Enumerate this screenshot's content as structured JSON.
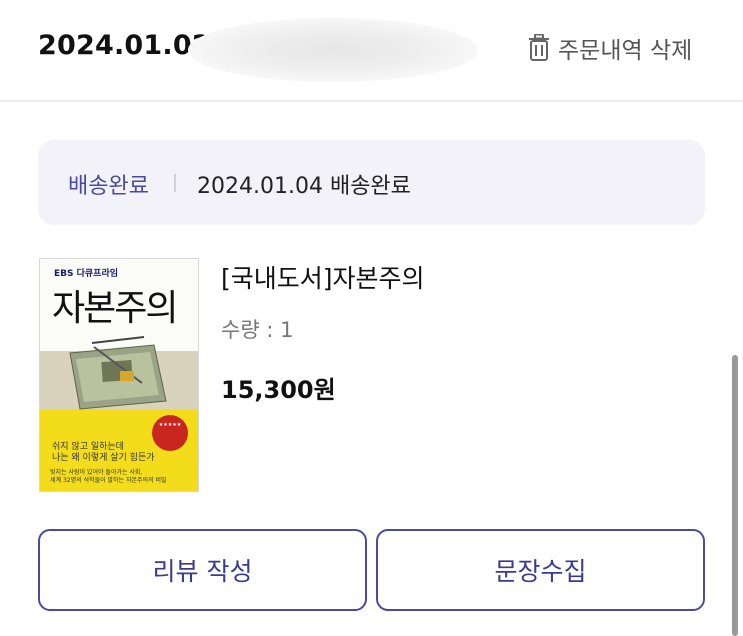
{
  "header": {
    "order_date": "2024.01.02",
    "delete_label": "주문내역 삭제",
    "delete_icon": "trash-icon"
  },
  "status": {
    "label": "배송완료",
    "detail": "2024.01.04 배송완료"
  },
  "item": {
    "title": "[국내도서]자본주의",
    "quantity": "수량 : 1",
    "price": "15,300원",
    "cover": {
      "brand": "EBS  다큐프라임",
      "title": "자본주의",
      "subtitle_line1": "쉬지 않고 일하는데",
      "subtitle_line2": "나는 왜 이렇게 살기 힘든가",
      "tagline_line1": "빚지는 사람이 있어야 돌아가는 사회,",
      "tagline_line2": "세계 32명의 석학들이 말하는 자본주의의 비밀"
    }
  },
  "buttons": {
    "review": "리뷰 작성",
    "collect": "문장수집"
  },
  "colors": {
    "accent": "#4a4aa0",
    "status_bg": "#f2f2f8",
    "cover_yellow": "#f3dd1a"
  }
}
